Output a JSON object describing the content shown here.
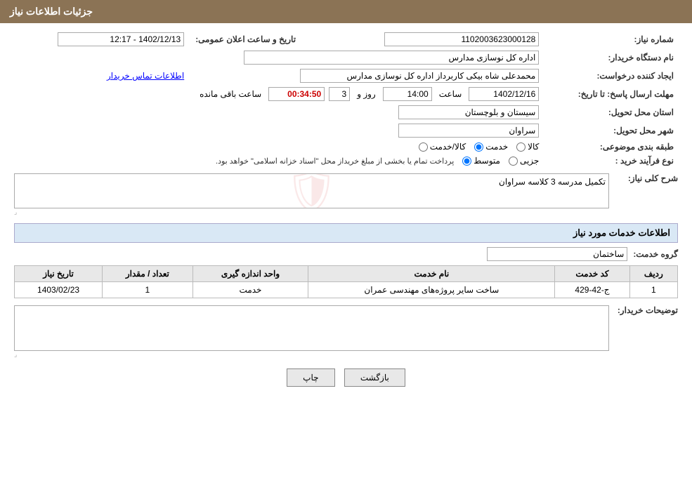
{
  "header": {
    "title": "جزئیات اطلاعات نیاز"
  },
  "fields": {
    "need_number_label": "شماره نیاز:",
    "need_number_value": "1102003623000128",
    "announce_date_label": "تاریخ و ساعت اعلان عمومی:",
    "announce_date_value": "1402/12/13 - 12:17",
    "buyer_org_label": "نام دستگاه خریدار:",
    "buyer_org_value": "اداره کل نوسازی مدارس",
    "requester_label": "ایجاد کننده درخواست:",
    "requester_value": "محمدعلی شاه بیکی کاربرداز اداره کل نوسازی مدارس",
    "contact_link": "اطلاعات تماس خریدار",
    "deadline_label": "مهلت ارسال پاسخ: تا تاریخ:",
    "deadline_date": "1402/12/16",
    "deadline_time_label": "ساعت",
    "deadline_time": "14:00",
    "deadline_days_label": "روز و",
    "deadline_days": "3",
    "deadline_remaining_label": "ساعت باقی مانده",
    "deadline_remaining": "00:34:50",
    "province_label": "استان محل تحویل:",
    "province_value": "سیستان و بلوچستان",
    "city_label": "شهر محل تحویل:",
    "city_value": "سراوان",
    "category_label": "طبقه بندی موضوعی:",
    "category_options": [
      "کالا",
      "خدمت",
      "کالا/خدمت"
    ],
    "category_selected": "خدمت",
    "purchase_type_label": "نوع فرآیند خرید :",
    "purchase_type_options": [
      "جزیی",
      "متوسط"
    ],
    "purchase_type_note": "پرداخت تمام یا بخشی از مبلغ خریداز محل \"اسناد خزانه اسلامی\" خواهد بود.",
    "need_desc_label": "شرح کلی نیاز:",
    "need_desc_value": "تکمیل مدرسه 3 کلاسه سراوان",
    "services_section_title": "اطلاعات خدمات مورد نیاز",
    "service_group_label": "گروه خدمت:",
    "service_group_value": "ساختمان",
    "table_headers": [
      "ردیف",
      "کد خدمت",
      "نام خدمت",
      "واحد اندازه گیری",
      "تعداد / مقدار",
      "تاریخ نیاز"
    ],
    "table_rows": [
      {
        "row": "1",
        "code": "ج-42-429",
        "name": "ساخت سایر پروژه‌های مهندسی عمران",
        "unit": "خدمت",
        "quantity": "1",
        "date": "1403/02/23"
      }
    ],
    "buyer_notes_label": "توضیحات خریدار:",
    "buyer_notes_value": "",
    "btn_print": "چاپ",
    "btn_back": "بازگشت"
  }
}
